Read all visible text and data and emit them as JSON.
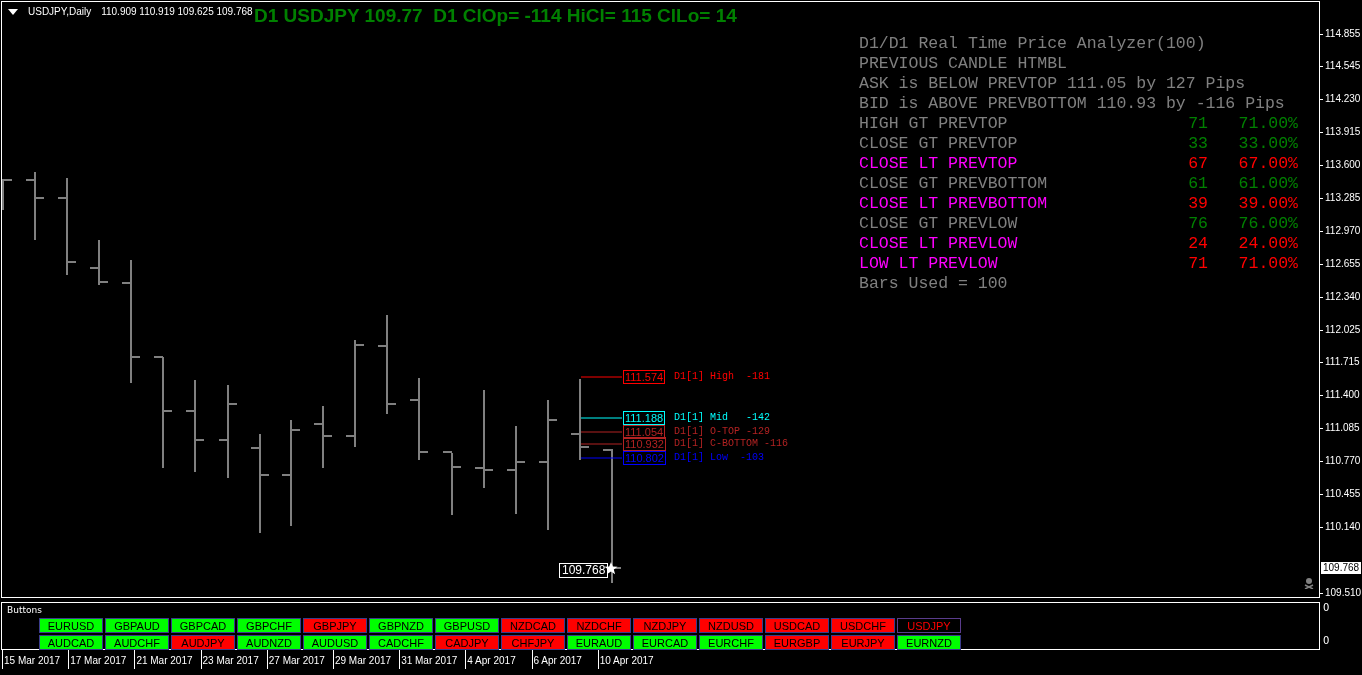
{
  "chart_header": {
    "symbol": "USDJPY,Daily",
    "ohlc": "110.909 110.919 109.625 109.768"
  },
  "title": "D1 USDJPY 109.77  D1 ClOp= -114 HiCl= 115 ClLo= 14",
  "analyzer": {
    "lines": [
      "D1/D1 Real Time Price Analyzer(100)",
      "PREVIOUS CANDLE HTMBL",
      "ASK is BELOW PREVTOP 111.05 by 127 Pips",
      "BID is ABOVE PREVBOTTOM 110.93 by -116 Pips"
    ],
    "rows": [
      {
        "label": "HIGH GT PREVTOP",
        "highlighted": false,
        "color": "#008000",
        "count": "71",
        "percent": "71.00%"
      },
      {
        "label": "CLOSE GT PREVTOP",
        "highlighted": false,
        "color": "#008000",
        "count": "33",
        "percent": "33.00%"
      },
      {
        "label": "CLOSE LT PREVTOP",
        "highlighted": true,
        "color": "#ff0000",
        "count": "67",
        "percent": "67.00%"
      },
      {
        "label": "CLOSE GT PREVBOTTOM",
        "highlighted": false,
        "color": "#008000",
        "count": "61",
        "percent": "61.00%"
      },
      {
        "label": "CLOSE LT PREVBOTTOM",
        "highlighted": true,
        "color": "#ff0000",
        "count": "39",
        "percent": "39.00%"
      },
      {
        "label": "CLOSE GT PREVLOW",
        "highlighted": false,
        "color": "#008000",
        "count": "76",
        "percent": "76.00%"
      },
      {
        "label": "CLOSE LT PREVLOW",
        "highlighted": true,
        "color": "#ff0000",
        "count": "24",
        "percent": "24.00%"
      },
      {
        "label": "LOW LT PREVLOW",
        "highlighted": true,
        "color": "#ff0000",
        "count": "71",
        "percent": "71.00%"
      }
    ],
    "footer": "Bars Used = 100"
  },
  "levels": [
    {
      "price": "111.574",
      "label": "D1[1] High  -181",
      "color": "#ff0000"
    },
    {
      "price": "111.188",
      "label": "D1[1] Mid   -142",
      "color": "#00ffff"
    },
    {
      "price": "111.054",
      "label": "D1[1] O-TOP -129",
      "color": "#b22222"
    },
    {
      "price": "110.932",
      "label": "D1[1] C-BOTTOM -116",
      "color": "#b22222"
    },
    {
      "price": "110.802",
      "label": "D1[1] Low  -103",
      "color": "#0000ff"
    }
  ],
  "current_price": "109.768",
  "price_axis": [
    "114.855",
    "114.545",
    "114.230",
    "113.915",
    "113.600",
    "113.285",
    "112.970",
    "112.655",
    "112.340",
    "112.025",
    "111.715",
    "111.400",
    "111.085",
    "110.770",
    "110.455",
    "110.140",
    "109.510"
  ],
  "axis_price_label": "109.768",
  "indicator": {
    "title": "Buttons",
    "axis": [
      "0",
      "0"
    ],
    "buttons": [
      [
        {
          "label": "EURUSD",
          "color": "#00ff00",
          "selected": false
        },
        {
          "label": "GBPAUD",
          "color": "#00ff00",
          "selected": false
        },
        {
          "label": "GBPCAD",
          "color": "#00ff00",
          "selected": false
        },
        {
          "label": "GBPCHF",
          "color": "#00ff00",
          "selected": false
        },
        {
          "label": "GBPJPY",
          "color": "#ff0000",
          "selected": false
        },
        {
          "label": "GBPNZD",
          "color": "#00ff00",
          "selected": false
        },
        {
          "label": "GBPUSD",
          "color": "#00ff00",
          "selected": false
        },
        {
          "label": "NZDCAD",
          "color": "#ff0000",
          "selected": false
        },
        {
          "label": "NZDCHF",
          "color": "#ff0000",
          "selected": false
        },
        {
          "label": "NZDJPY",
          "color": "#ff0000",
          "selected": false
        },
        {
          "label": "NZDUSD",
          "color": "#ff0000",
          "selected": false
        },
        {
          "label": "USDCAD",
          "color": "#ff0000",
          "selected": false
        },
        {
          "label": "USDCHF",
          "color": "#ff0000",
          "selected": false
        },
        {
          "label": "USDJPY",
          "color": "#ff0000",
          "selected": true
        }
      ],
      [
        {
          "label": "AUDCAD",
          "color": "#00ff00",
          "selected": false
        },
        {
          "label": "AUDCHF",
          "color": "#00ff00",
          "selected": false
        },
        {
          "label": "AUDJPY",
          "color": "#ff0000",
          "selected": false
        },
        {
          "label": "AUDNZD",
          "color": "#00ff00",
          "selected": false
        },
        {
          "label": "AUDUSD",
          "color": "#00ff00",
          "selected": false
        },
        {
          "label": "CADCHF",
          "color": "#00ff00",
          "selected": false
        },
        {
          "label": "CADJPY",
          "color": "#ff0000",
          "selected": false
        },
        {
          "label": "CHFJPY",
          "color": "#ff0000",
          "selected": false
        },
        {
          "label": "EURAUD",
          "color": "#00ff00",
          "selected": false
        },
        {
          "label": "EURCAD",
          "color": "#00ff00",
          "selected": false
        },
        {
          "label": "EURCHF",
          "color": "#00ff00",
          "selected": false
        },
        {
          "label": "EURGBP",
          "color": "#ff0000",
          "selected": false
        },
        {
          "label": "EURJPY",
          "color": "#ff0000",
          "selected": false
        },
        {
          "label": "EURNZD",
          "color": "#00ff00",
          "selected": false
        }
      ]
    ]
  },
  "time_axis": [
    "15 Mar 2017",
    "17 Mar 2017",
    "21 Mar 2017",
    "23 Mar 2017",
    "27 Mar 2017",
    "29 Mar 2017",
    "31 Mar 2017",
    "4 Apr 2017",
    "6 Apr 2017",
    "10 Apr 2017"
  ]
}
